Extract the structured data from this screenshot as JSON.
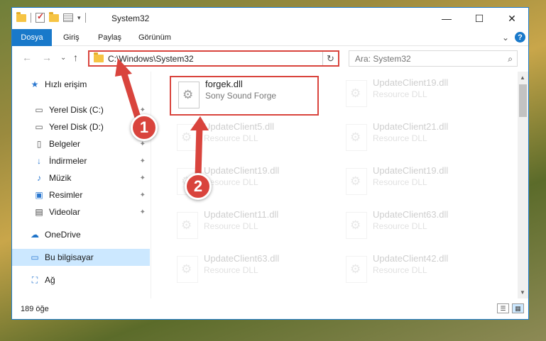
{
  "titlebar": {
    "title": "System32",
    "minimize_glyph": "—",
    "maximize_glyph": "☐",
    "close_glyph": "✕"
  },
  "ribbon": {
    "tabs": [
      "Dosya",
      "Giriş",
      "Paylaş",
      "Görünüm"
    ],
    "expand_glyph": "⌄",
    "help_glyph": "?"
  },
  "address": {
    "back_glyph": "←",
    "forward_glyph": "→",
    "recent_glyph": "⌄",
    "up_glyph": "↑",
    "path": "C:\\Windows\\System32",
    "refresh_glyph": "↻",
    "search_placeholder": "Ara: System32",
    "search_glyph": "⌕"
  },
  "sidebar": {
    "items": [
      {
        "label": "Hızlı erişim",
        "icon": "star-icon",
        "glyph": "★",
        "color": "#2b78d0",
        "pinned": false
      },
      {
        "label": "Yerel Disk (C:)",
        "icon": "drive-icon",
        "glyph": "▭",
        "color": "#555555",
        "pinned": true
      },
      {
        "label": "Yerel Disk (D:)",
        "icon": "drive-icon",
        "glyph": "▭",
        "color": "#555555",
        "pinned": true
      },
      {
        "label": "Belgeler",
        "icon": "document-icon",
        "glyph": "▯",
        "color": "#555555",
        "pinned": true
      },
      {
        "label": "İndirmeler",
        "icon": "download-icon",
        "glyph": "↓",
        "color": "#2b78d0",
        "pinned": true
      },
      {
        "label": "Müzik",
        "icon": "music-icon",
        "glyph": "♪",
        "color": "#2b78d0",
        "pinned": true
      },
      {
        "label": "Resimler",
        "icon": "pictures-icon",
        "glyph": "▣",
        "color": "#2b78d0",
        "pinned": true
      },
      {
        "label": "Videolar",
        "icon": "video-icon",
        "glyph": "▤",
        "color": "#444444",
        "pinned": true
      },
      {
        "label": "OneDrive",
        "icon": "cloud-icon",
        "glyph": "☁",
        "color": "#1e73c8",
        "pinned": false
      },
      {
        "label": "Bu bilgisayar",
        "icon": "computer-icon",
        "glyph": "▭",
        "color": "#2b78d0",
        "pinned": false,
        "selected": true
      },
      {
        "label": "Ağ",
        "icon": "network-icon",
        "glyph": "⛶",
        "color": "#2b78d0",
        "pinned": false
      }
    ],
    "pin_glyph": "📌"
  },
  "files": [
    {
      "name": "forgek.dll",
      "desc": "Sony Sound Forge",
      "faded": false,
      "highlight": true
    },
    {
      "name": "UpdateClient19.dll",
      "desc": "Resource DLL",
      "faded": true
    },
    {
      "name": "UpdateClient5.dll",
      "desc": "Resource DLL",
      "faded": true
    },
    {
      "name": "UpdateClient21.dll",
      "desc": "Resource DLL",
      "faded": true
    },
    {
      "name": "UpdateClient19.dll",
      "desc": "Resource DLL",
      "faded": true
    },
    {
      "name": "UpdateClient19.dll",
      "desc": "Resource DLL",
      "faded": true
    },
    {
      "name": "UpdateClient11.dll",
      "desc": "Resource DLL",
      "faded": true
    },
    {
      "name": "UpdateClient63.dll",
      "desc": "Resource DLL",
      "faded": true
    },
    {
      "name": "UpdateClient63.dll",
      "desc": "Resource DLL",
      "faded": true
    },
    {
      "name": "UpdateClient42.dll",
      "desc": "Resource DLL",
      "faded": true
    }
  ],
  "status": {
    "count_text": "189 öğe"
  },
  "callouts": {
    "step1": "1",
    "step2": "2",
    "color": "#d9443d"
  }
}
